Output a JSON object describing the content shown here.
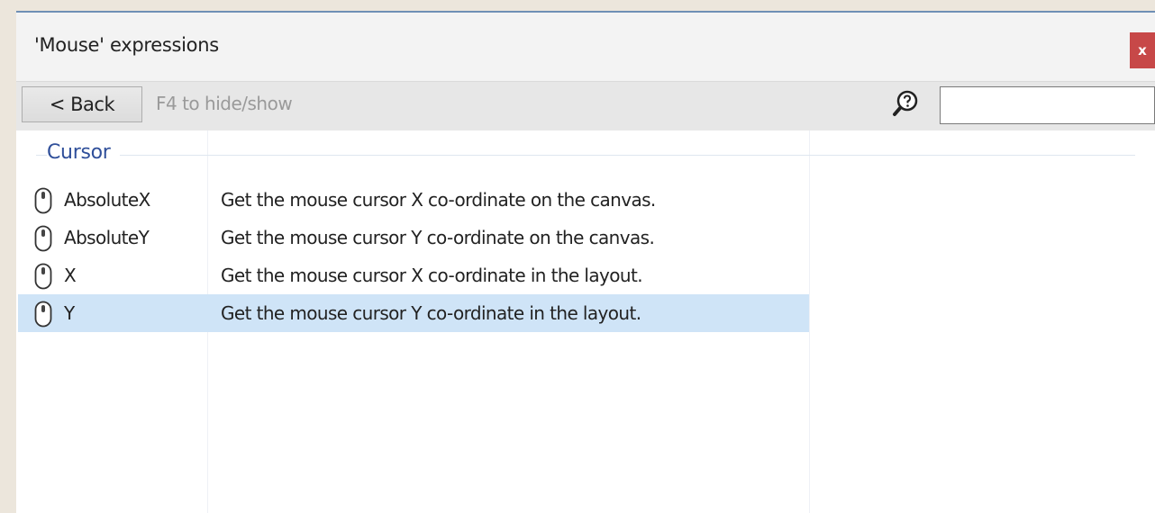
{
  "dialog": {
    "title": "'Mouse' expressions",
    "close_label": "x"
  },
  "toolbar": {
    "back_label": "< Back",
    "hint": "F4 to hide/show",
    "search": {
      "value": "",
      "placeholder": ""
    }
  },
  "group": {
    "label": "Cursor",
    "items": [
      {
        "name": "AbsoluteX",
        "description": "Get the mouse cursor X co-ordinate on the canvas.",
        "icon": "mouse-icon",
        "selected": false
      },
      {
        "name": "AbsoluteY",
        "description": "Get the mouse cursor Y co-ordinate on the canvas.",
        "icon": "mouse-icon",
        "selected": false
      },
      {
        "name": "X",
        "description": "Get the mouse cursor X co-ordinate in the layout.",
        "icon": "mouse-icon",
        "selected": false
      },
      {
        "name": "Y",
        "description": "Get the mouse cursor Y co-ordinate in the layout.",
        "icon": "mouse-icon",
        "selected": true
      }
    ]
  },
  "colors": {
    "selection": "#cfe4f7",
    "group_label": "#2f4f9a",
    "close_button": "#c74848",
    "title_border": "#6f8fb5"
  }
}
